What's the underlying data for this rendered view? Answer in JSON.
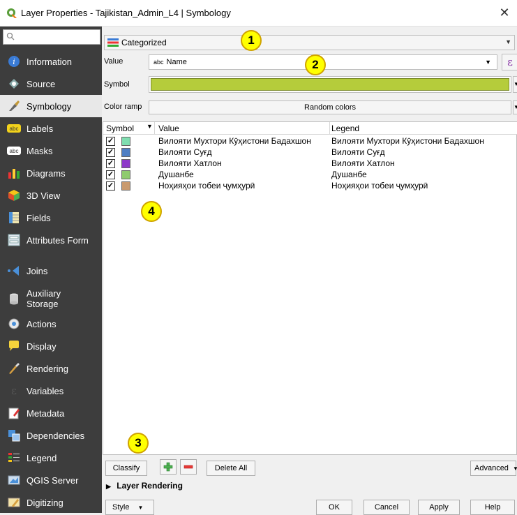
{
  "window": {
    "title": "Layer Properties - Tajikistan_Admin_L4 | Symbology",
    "close_glyph": "✕"
  },
  "sidebar": {
    "search_placeholder": "",
    "items": [
      {
        "label": "Information",
        "icon": "info-icon"
      },
      {
        "label": "Source",
        "icon": "source-icon"
      },
      {
        "label": "Symbology",
        "icon": "symbology-icon",
        "selected": true
      },
      {
        "label": "Labels",
        "icon": "labels-icon"
      },
      {
        "label": "Masks",
        "icon": "masks-icon"
      },
      {
        "label": "Diagrams",
        "icon": "diagrams-icon"
      },
      {
        "label": "3D View",
        "icon": "3d-view-icon"
      },
      {
        "label": "Fields",
        "icon": "fields-icon"
      },
      {
        "label": "Attributes Form",
        "icon": "attributes-form-icon"
      },
      {
        "label": "Joins",
        "icon": "joins-icon"
      },
      {
        "label": "Auxiliary Storage",
        "icon": "auxiliary-storage-icon"
      },
      {
        "label": "Actions",
        "icon": "actions-icon"
      },
      {
        "label": "Display",
        "icon": "display-icon"
      },
      {
        "label": "Rendering",
        "icon": "rendering-icon"
      },
      {
        "label": "Variables",
        "icon": "variables-icon"
      },
      {
        "label": "Metadata",
        "icon": "metadata-icon"
      },
      {
        "label": "Dependencies",
        "icon": "dependencies-icon"
      },
      {
        "label": "Legend",
        "icon": "legend-icon"
      },
      {
        "label": "QGIS Server",
        "icon": "qgis-server-icon"
      },
      {
        "label": "Digitizing",
        "icon": "digitizing-icon"
      }
    ]
  },
  "symbology": {
    "renderer": "Categorized",
    "value_label": "Value",
    "value_field_type": "abc",
    "value_field": "Name",
    "expression_glyph": "ε",
    "symbol_label": "Symbol",
    "symbol_color": "#b5cc3b",
    "color_ramp_label": "Color ramp",
    "color_ramp_value": "Random colors"
  },
  "table": {
    "columns": [
      "Symbol",
      "Value",
      "Legend"
    ],
    "rows": [
      {
        "checked": true,
        "color": "#7fdeb0",
        "value": "Вилояти Мухтори Кӯҳистони Бадахшон",
        "legend": "Вилояти Мухтори Кӯҳистони Бадахшон"
      },
      {
        "checked": true,
        "color": "#4f7fc4",
        "value": "Вилояти Суғд",
        "legend": "Вилояти Суғд"
      },
      {
        "checked": true,
        "color": "#8e3ac9",
        "value": "Вилояти Хатлон",
        "legend": "Вилояти Хатлон"
      },
      {
        "checked": true,
        "color": "#8fcb6e",
        "value": "Душанбе",
        "legend": "Душанбе"
      },
      {
        "checked": true,
        "color": "#c99a6e",
        "value": "Ноҳияҳои тобеи ҷумҳурӣ",
        "legend": "Ноҳияҳои тобеи ҷумҳурӣ"
      }
    ],
    "check_glyph": "✓"
  },
  "buttons": {
    "classify": "Classify",
    "delete_all": "Delete All",
    "advanced": "Advanced",
    "layer_rendering": "Layer Rendering",
    "style": "Style",
    "ok": "OK",
    "cancel": "Cancel",
    "apply": "Apply",
    "help": "Help"
  },
  "markers": [
    "1",
    "2",
    "3",
    "4"
  ]
}
